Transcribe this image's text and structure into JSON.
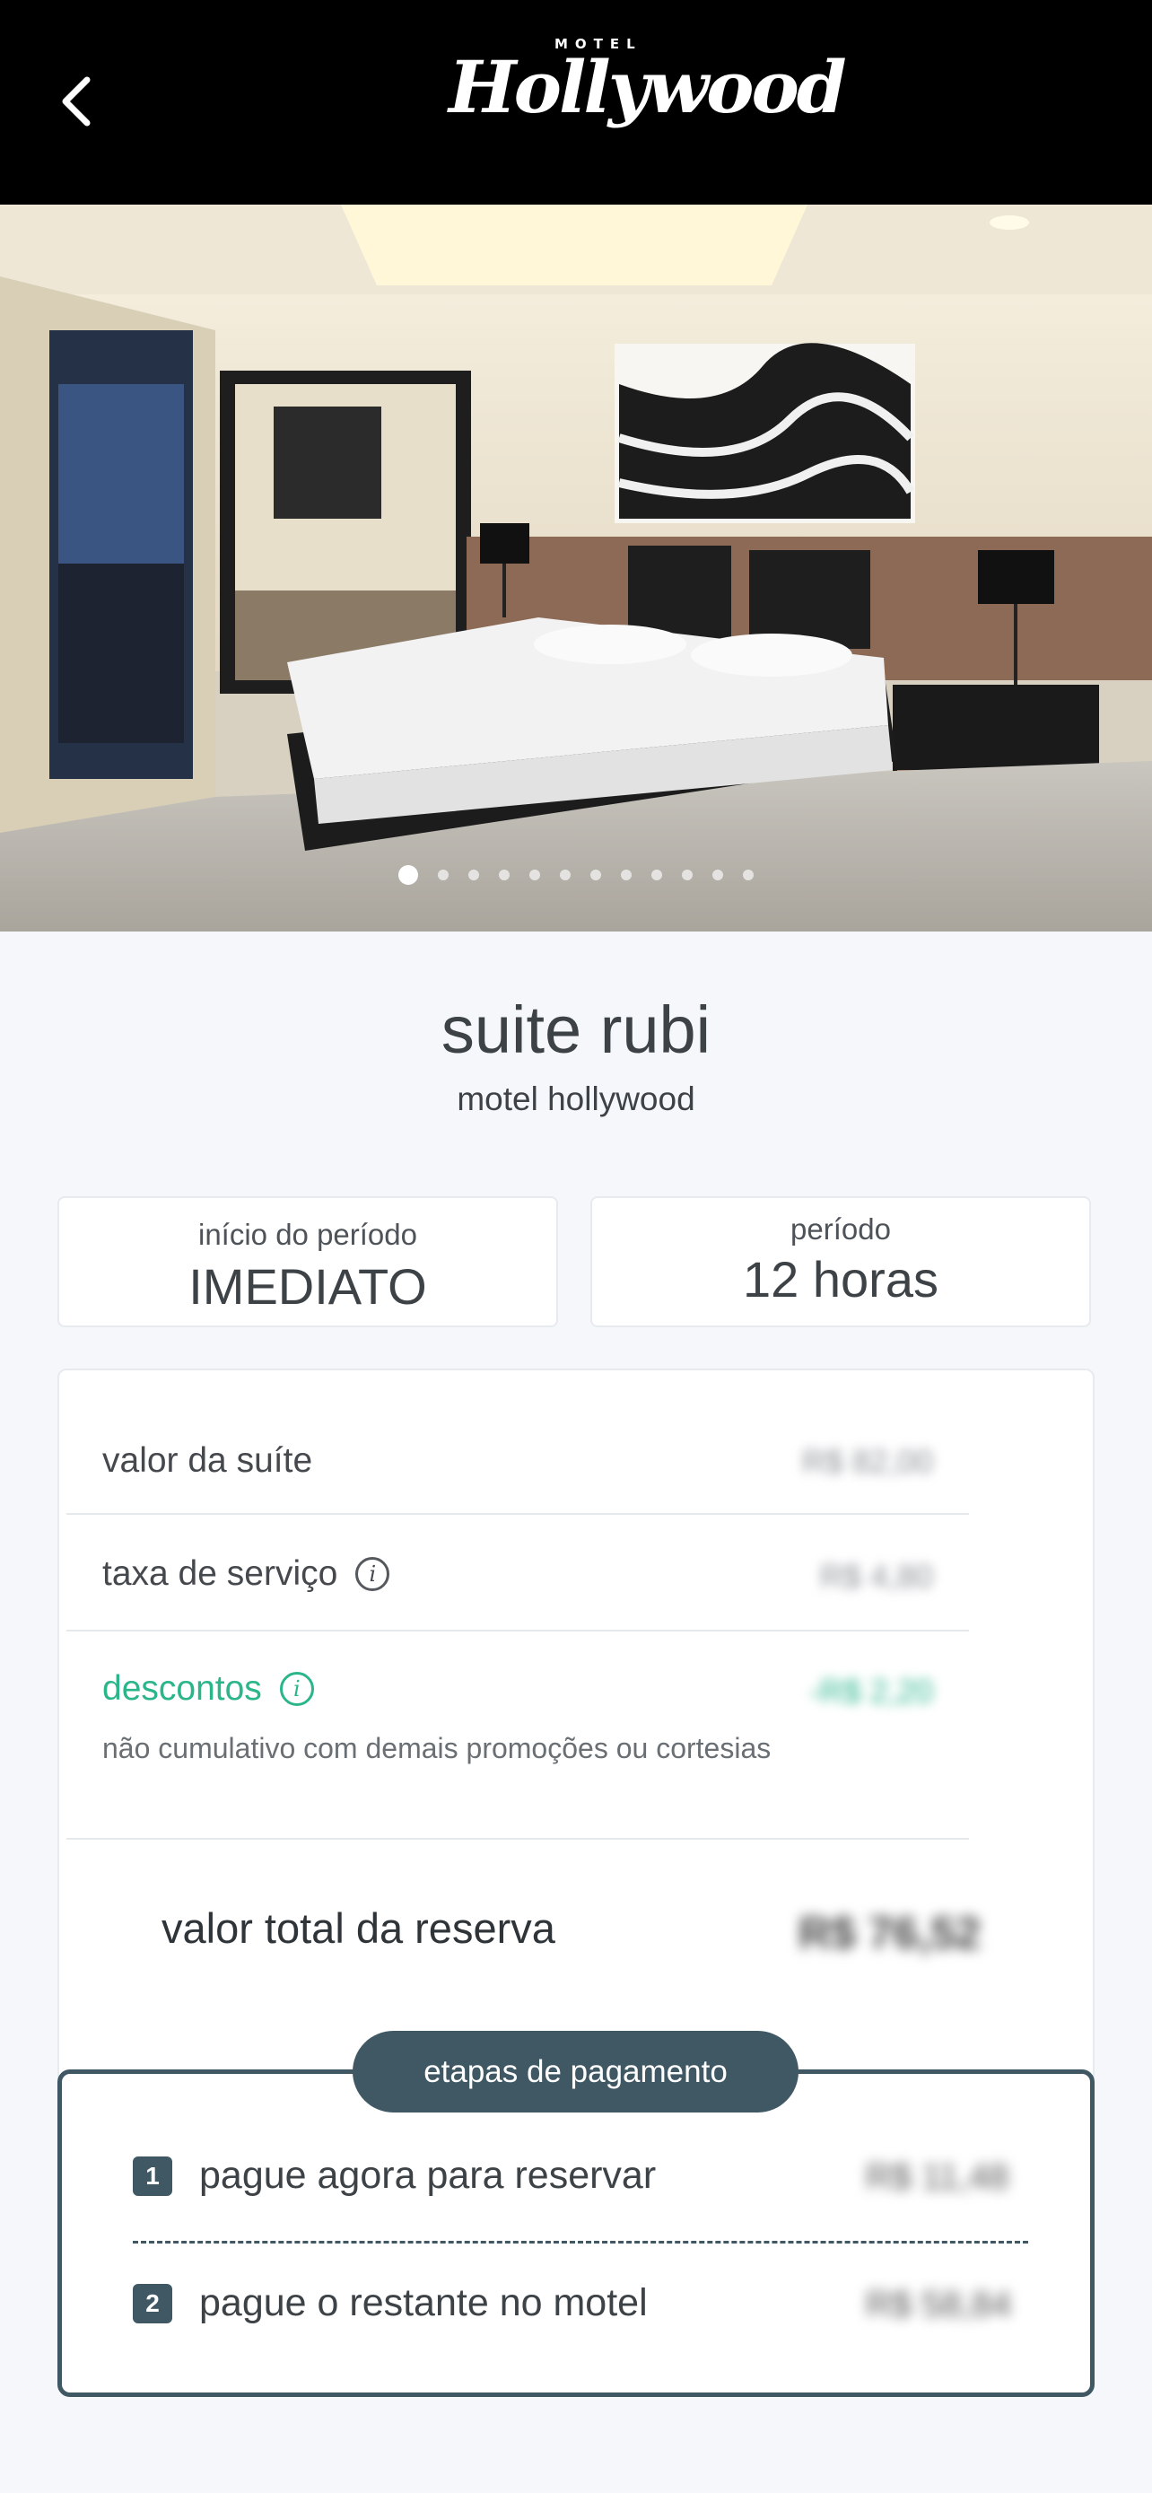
{
  "header": {
    "logo_small": "MOTEL",
    "logo_main": "Hollywood",
    "back_icon": "chevron-left-icon"
  },
  "gallery": {
    "image_count": 12,
    "active_index": 0
  },
  "suite": {
    "name": "suite rubi",
    "motel": "motel hollywood"
  },
  "start": {
    "label": "início do período",
    "value": "IMEDIATO"
  },
  "period": {
    "label": "período",
    "value": "12 horas"
  },
  "pricing": {
    "suite_value_label": "valor da suíte",
    "suite_value": "R$ 82,00",
    "service_fee_label": "taxa de serviço",
    "service_fee": "R$ 4,80",
    "discount_label": "descontos",
    "discount_value": "-R$ 2,20",
    "discount_note": "não cumulativo com demais promoções ou cortesias",
    "total_label": "valor total da reserva",
    "total_value": "R$ 76,52"
  },
  "payment": {
    "title": "etapas de pagamento",
    "steps": [
      {
        "num": "1",
        "label": "pague agora para reservar",
        "value": "R$ 11,48"
      },
      {
        "num": "2",
        "label": "pague o restante no motel",
        "value": "R$ 58,84"
      }
    ]
  },
  "colors": {
    "accent_dark": "#3f5864",
    "discount_green": "#2bb58a",
    "header_bg": "#000000"
  }
}
